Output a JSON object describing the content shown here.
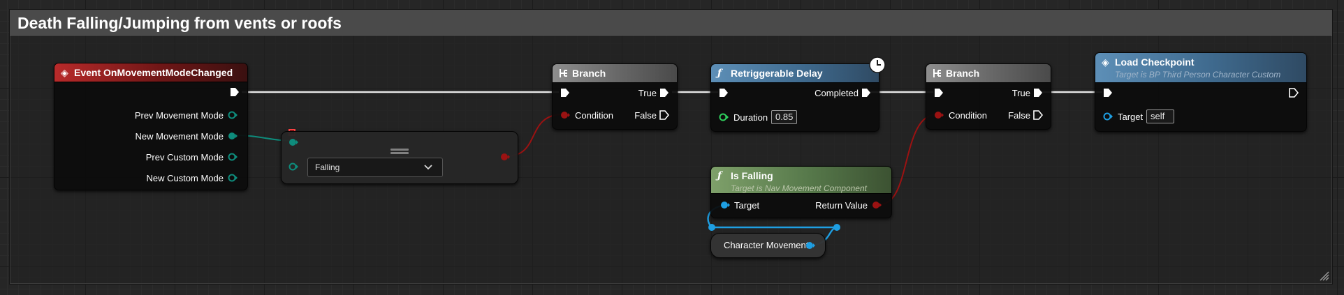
{
  "comment": {
    "title": "Death Falling/Jumping from vents or roofs"
  },
  "colors": {
    "exec": "#ffffff",
    "enum_pin": "#0e8c7c",
    "bool_pin": "#9b1212",
    "float_pin": "#2fcf5d",
    "object_pin": "#1e9fe3"
  },
  "nodes": {
    "event": {
      "title": "Event OnMovementModeChanged",
      "pins": [
        "Prev Movement Mode",
        "New Movement Mode",
        "Prev Custom Mode",
        "New Custom Mode"
      ]
    },
    "equal": {
      "option": "Falling"
    },
    "branch1": {
      "title": "Branch",
      "true_label": "True",
      "false_label": "False",
      "condition_label": "Condition"
    },
    "delay": {
      "title": "Retriggerable Delay",
      "completed_label": "Completed",
      "duration_label": "Duration",
      "duration_value": "0.85"
    },
    "branch2": {
      "title": "Branch",
      "true_label": "True",
      "false_label": "False",
      "condition_label": "Condition"
    },
    "load": {
      "title": "Load Checkpoint",
      "subtitle": "Target is BP Third Person Character Custom",
      "target_label": "Target",
      "target_value": "self"
    },
    "isfalling": {
      "title": "Is Falling",
      "subtitle": "Target is Nav Movement Component",
      "target_label": "Target",
      "return_label": "Return Value"
    },
    "charmove": {
      "title": "Character Movement"
    }
  }
}
